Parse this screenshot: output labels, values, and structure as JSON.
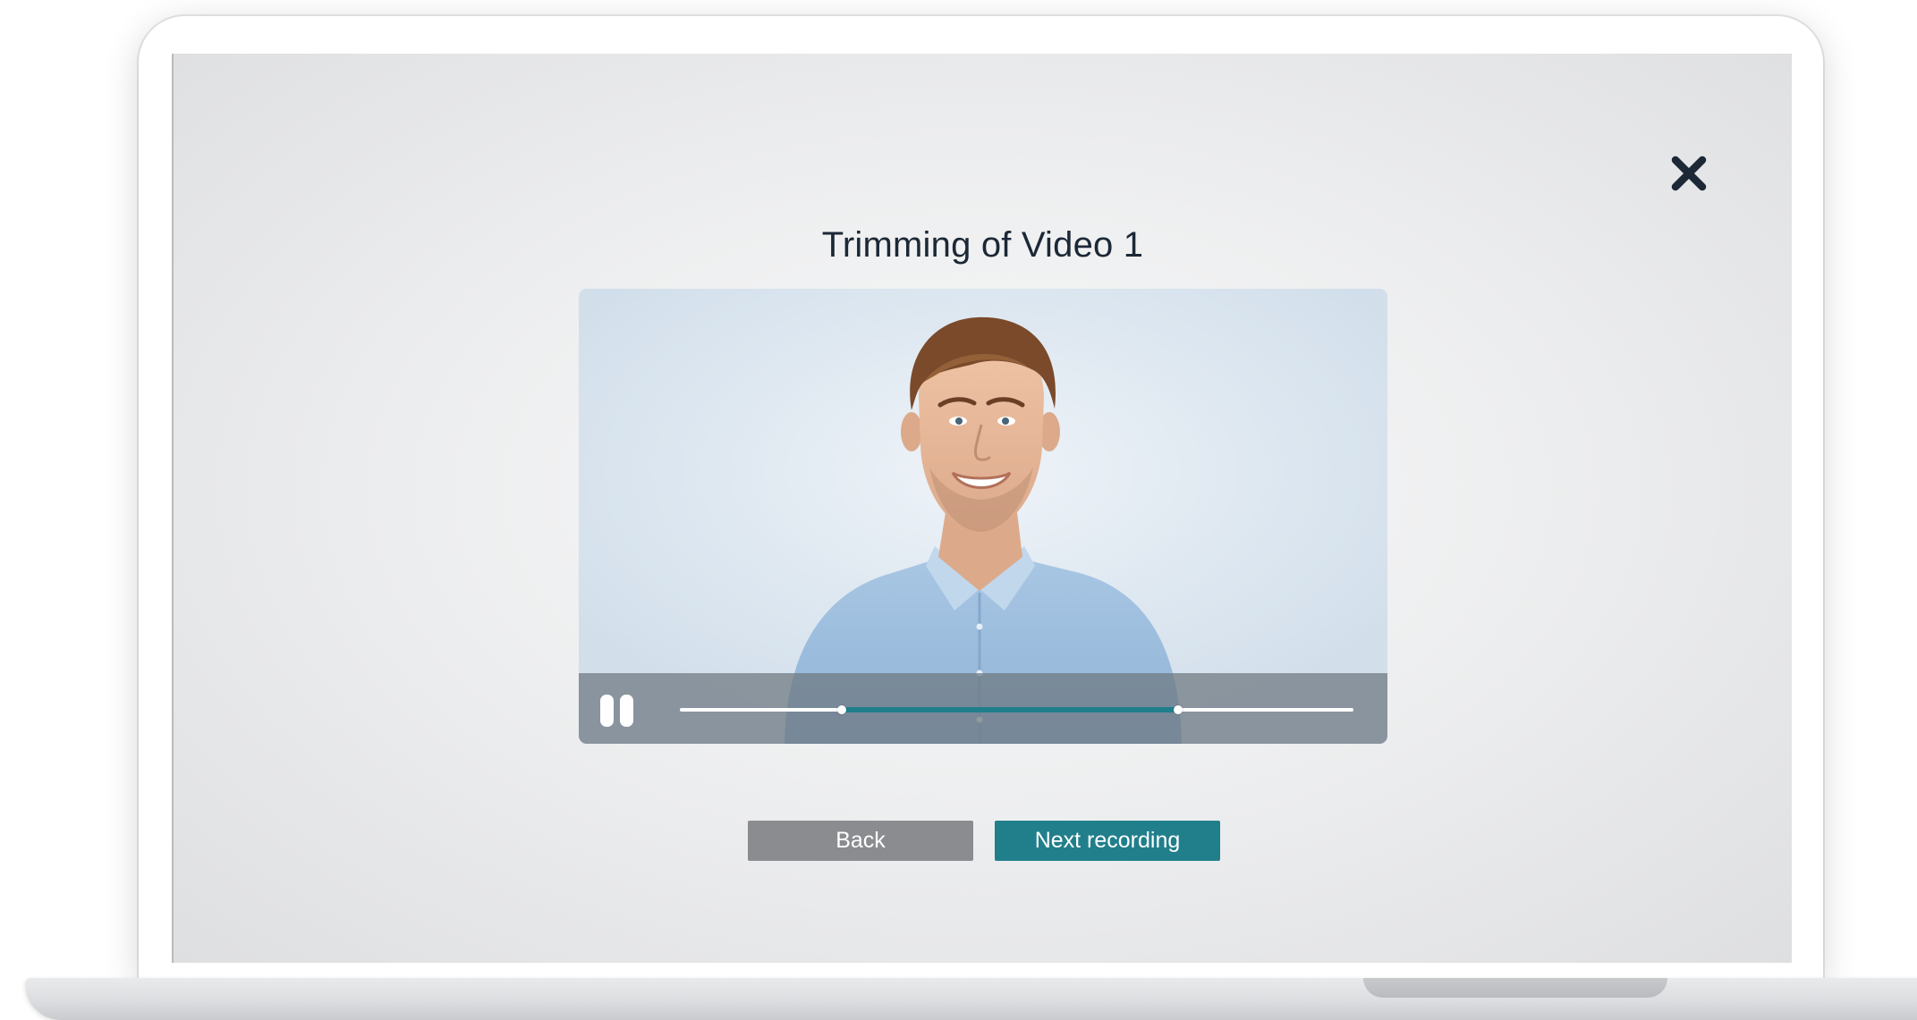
{
  "dialog": {
    "title": "Trimming of Video 1",
    "close_icon": "close-icon"
  },
  "player": {
    "state": "playing",
    "control_icon": "pause-icon",
    "trim": {
      "start": 0.24,
      "end": 0.74
    }
  },
  "actions": {
    "back_label": "Back",
    "next_label": "Next recording"
  },
  "colors": {
    "title_text": "#1c2836",
    "close_icon": "#1c2836",
    "back_button": "#8a8c90",
    "next_button": "#217f8b",
    "trim_range": "#1f7f8c",
    "controls_overlay": "#6e7780"
  }
}
